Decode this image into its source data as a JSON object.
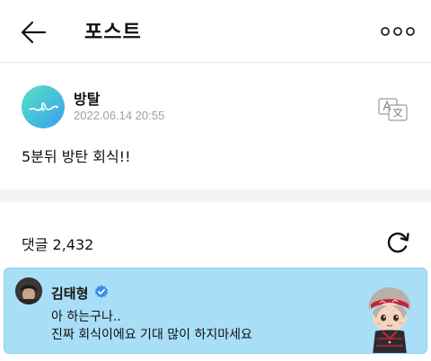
{
  "header": {
    "title": "포스트"
  },
  "post": {
    "author": "방탈",
    "date": "2022.06.14 20:55",
    "text": "5분뒤 방탄 회식!!"
  },
  "comments": {
    "count_label": "댓글 2,432"
  },
  "comment": {
    "author": "김태형",
    "line1": "아 하는구나..",
    "line2": "진짜 회식이에요 기대 많이 하지마세요"
  },
  "icons": {
    "back": "arrow-left-icon",
    "more": "more-dots-icon",
    "translate": "translate-icon",
    "refresh": "refresh-icon",
    "verified": "verified-badge-icon"
  },
  "colors": {
    "avatar_gradient_start": "#4fe0c0",
    "avatar_gradient_end": "#3aa8f0",
    "comment_highlight": "#a9def7",
    "verified": "#3b8fe6",
    "date_gray": "#a0a0a0"
  }
}
